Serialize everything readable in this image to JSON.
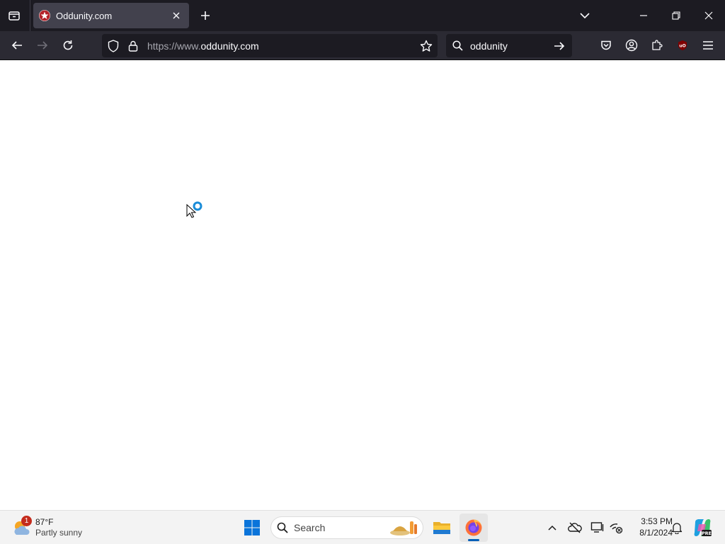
{
  "browser": {
    "tab": {
      "title": "Oddunity.com"
    },
    "urlbar": {
      "url_prefix": "https://www.",
      "url_domain": "oddunity.com"
    },
    "searchbar": {
      "query": "oddunity"
    }
  },
  "taskbar": {
    "weather": {
      "temp": "87°F",
      "description": "Partly sunny",
      "badge": "1"
    },
    "search": {
      "placeholder": "Search"
    },
    "clock": {
      "time": "3:53 PM",
      "date": "8/1/2024"
    }
  },
  "colors": {
    "tab_strip_bg": "#1c1b22",
    "toolbar_bg": "#2b2a33",
    "accent": "#005fb8"
  },
  "icons": [
    "tab-list-icon",
    "close-icon",
    "plus-icon",
    "chevron-down-icon",
    "minimize-icon",
    "restore-icon",
    "back-arrow-icon",
    "forward-arrow-icon",
    "reload-icon",
    "shield-icon",
    "lock-icon",
    "star-icon",
    "search-icon",
    "arrow-right-icon",
    "pocket-icon",
    "account-icon",
    "extensions-icon",
    "ublock-icon",
    "menu-icon",
    "windows-start-icon",
    "file-explorer-icon",
    "firefox-icon"
  ]
}
